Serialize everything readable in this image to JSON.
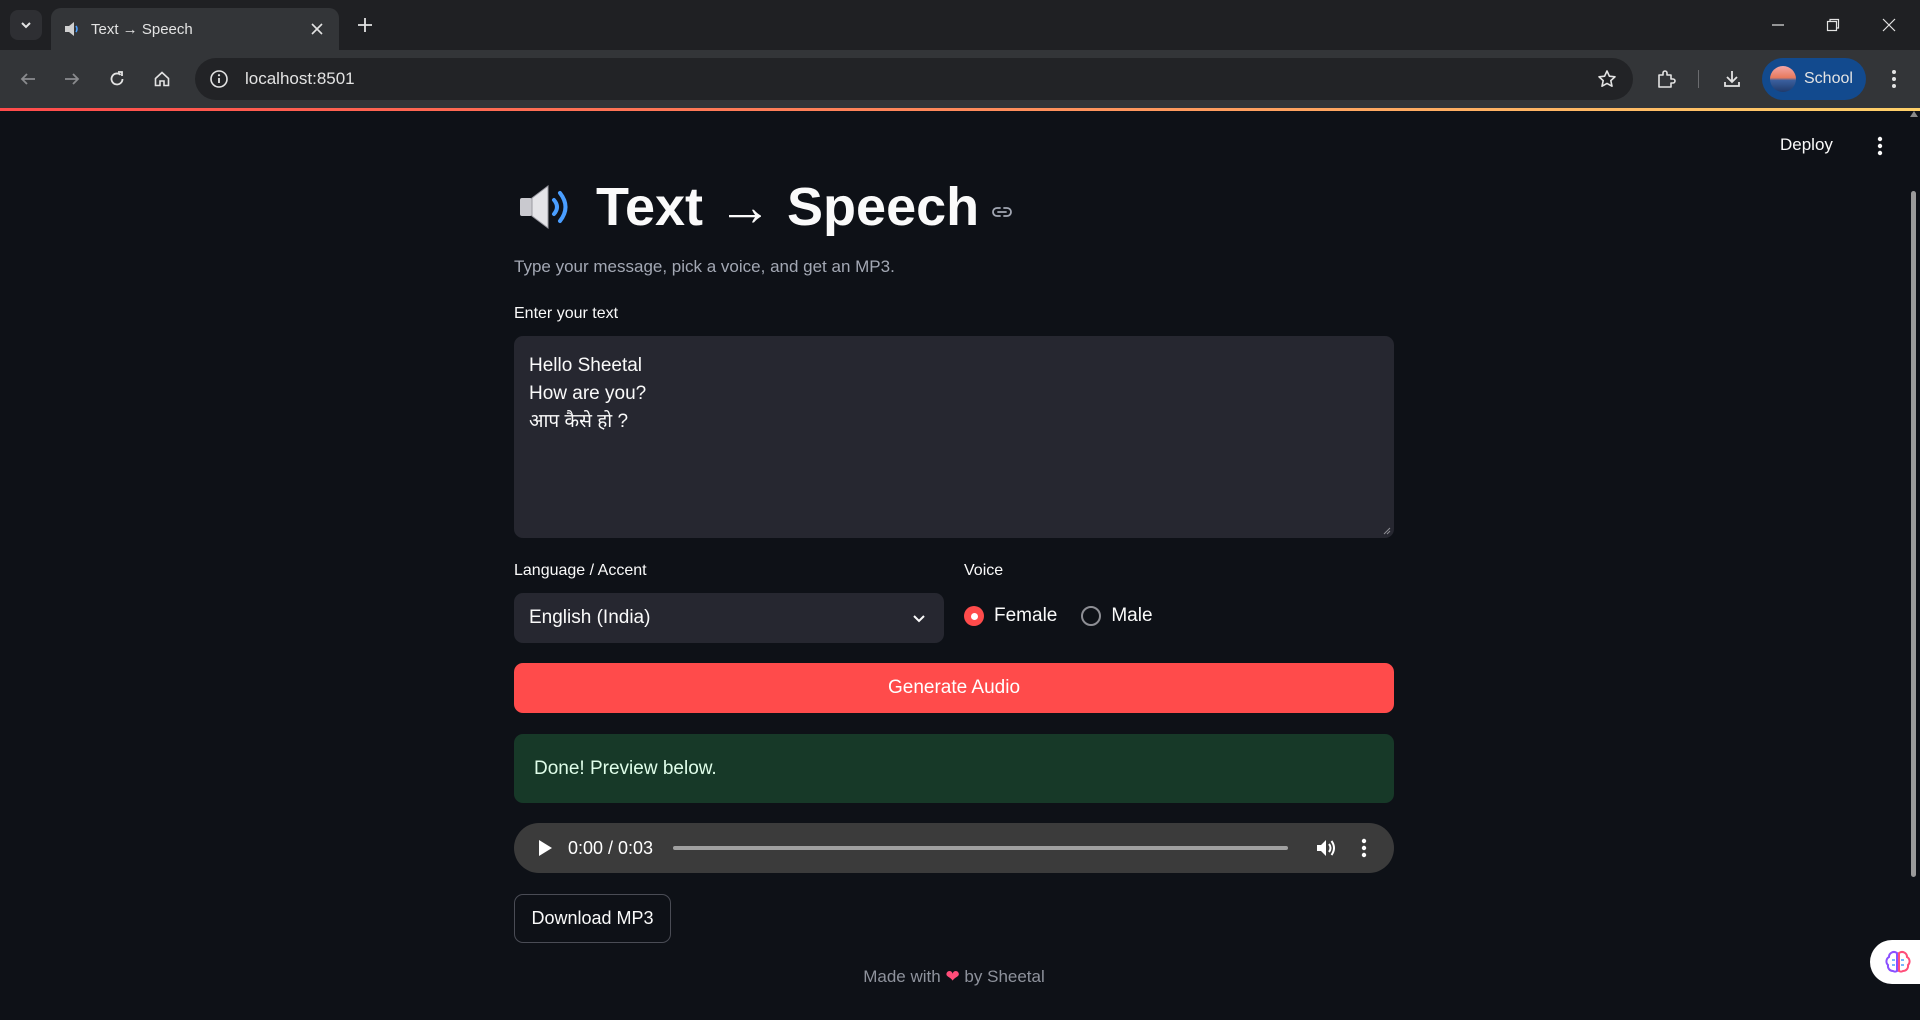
{
  "browser": {
    "tab_title": "Text → Speech",
    "url": "localhost:8501",
    "profile_label": "School"
  },
  "header": {
    "deploy_label": "Deploy"
  },
  "app": {
    "title_icon": "speaker-loud-icon",
    "title": "Text → Speech",
    "caption": "Type your message, pick a voice, and get an MP3.",
    "text_label": "Enter your text",
    "text_lines": [
      "Hello Sheetal",
      "How are you?",
      "आप कैसे हो ?"
    ],
    "language_label": "Language / Accent",
    "language_value": "English (India)",
    "voice_label": "Voice",
    "voice_options": [
      {
        "label": "Female",
        "selected": true
      },
      {
        "label": "Male",
        "selected": false
      }
    ],
    "generate_label": "Generate Audio",
    "success_message": "Done! Preview below.",
    "audio_time": "0:00 / 0:03",
    "audio_progress": 0,
    "download_label": "Download MP3",
    "footer_prefix": "Made with",
    "footer_heart": "❤",
    "footer_suffix": "by Sheetal"
  },
  "colors": {
    "accent": "#ff4b4b",
    "background": "#0e1117",
    "input_bg": "#262730",
    "success_bg": "#173928",
    "profile_bg": "#124a8e"
  }
}
